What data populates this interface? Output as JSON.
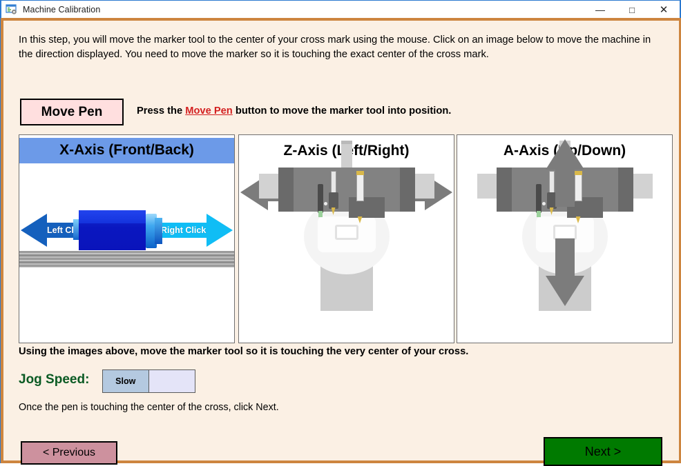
{
  "window": {
    "title": "Machine Calibration",
    "icon": "form-gear-icon",
    "controls": {
      "minimize": "—",
      "maximize": "□",
      "close": "✕"
    },
    "frame_color": "#cd853f",
    "background_color": "#fbf0e4"
  },
  "intro": {
    "text": "In this step, you will move the marker tool to the center of your cross mark using the mouse. Click on an image below to move the machine in the direction displayed. You need to move the marker so it is touching the exact center of the cross mark."
  },
  "move_pen": {
    "button_label": "Move Pen",
    "hint_before": "Press the ",
    "hint_link": "Move Pen",
    "hint_after": " button to move the marker tool into position.",
    "button_bg": "#ffdfdf",
    "link_color": "#d32020"
  },
  "panels": [
    {
      "title": "X-Axis (Front/Back)",
      "header_style": "blue",
      "header_color": "#6c9ae8",
      "left_arrow_label": "Left Click",
      "right_arrow_label": "Right Click",
      "left_arrow_color": "#1560bd",
      "right_arrow_color": "#10bdf5",
      "art": "lathe-x-axis"
    },
    {
      "title": "Z-Axis (Left/Right)",
      "header_style": "plain",
      "art": "machine-head-horizontal-arrows",
      "arrow_color": "#7c7c7c"
    },
    {
      "title": "A-Axis (Up/Down)",
      "header_style": "plain",
      "art": "machine-head-vertical-arrows",
      "arrow_color": "#7c7c7c"
    }
  ],
  "bold_instruction": "Using the images above, move the marker tool so it is touching the very center of your cross.",
  "jog_speed": {
    "label": "Jog Speed:",
    "label_color": "#0a5a23",
    "selected_option": "Slow",
    "unselected_option": "",
    "selected_bg": "#b4c9e0",
    "unselected_bg": "#e4e4f8"
  },
  "note": "Once the pen is touching the center of the cross, click Next.",
  "nav": {
    "previous_label": "< Previous",
    "previous_bg": "#cd919e",
    "next_label": "Next >",
    "next_bg": "#007a00"
  }
}
